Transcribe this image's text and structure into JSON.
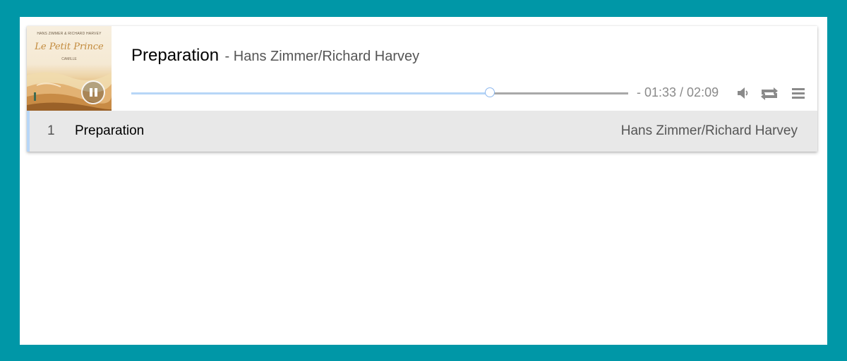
{
  "player": {
    "now_playing": {
      "title": "Preparation",
      "artist": "- Hans Zimmer/Richard Harvey",
      "progress_fraction": 0.723,
      "time_display": "- 01:33 / 02:09",
      "state": "playing"
    },
    "cover": {
      "artist_line": "HANS ZIMMER & RICHARD HARVEY",
      "title_line": "Le Petit Prince",
      "subtitle_line": "CAMILLE"
    },
    "controls": {
      "pause_icon": "pause-icon",
      "volume_icon": "volume-icon",
      "repeat_icon": "repeat-icon",
      "menu_icon": "menu-icon"
    }
  },
  "playlist": [
    {
      "index": "1",
      "title": "Preparation",
      "artist": "Hans Zimmer/Richard Harvey"
    }
  ],
  "colors": {
    "background": "#0097a7",
    "played_bar": "#b7d6f7",
    "row_highlight": "#e8e8e8"
  }
}
